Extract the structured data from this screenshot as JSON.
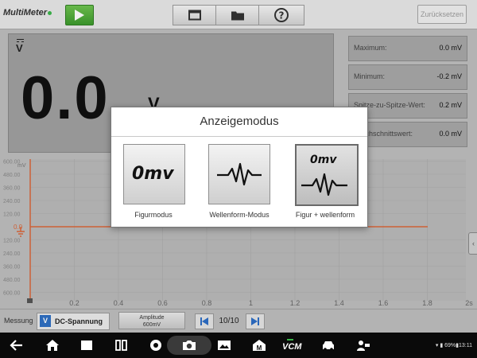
{
  "app": {
    "title": "MultiMeter",
    "reset_label": "Zurücksetzen"
  },
  "display": {
    "dc_symbol": "V",
    "value": "0.0",
    "unit": "V"
  },
  "stats": [
    {
      "label": "Maximum:",
      "value": "0.0 mV"
    },
    {
      "label": "Minimum:",
      "value": "-0.2 mV"
    },
    {
      "label": "Spitze-zu-Spitze-Wert:",
      "value": "0.2 mV"
    },
    {
      "label": "Durchschnittswert:",
      "value": "0.0 mV"
    }
  ],
  "chart": {
    "y_ticks_top": [
      "600.00",
      "480.00",
      "360.00",
      "240.00",
      "120.00"
    ],
    "y_unit": "mV",
    "zero_label": "0.0",
    "y_ticks_bottom": [
      "120.00",
      "240.00",
      "360.00",
      "480.00",
      "600.00"
    ],
    "x_ticks": [
      "0.2",
      "0.4",
      "0.6",
      "0.8",
      "1",
      "1.2",
      "1.4",
      "1.6",
      "1.8",
      "2s"
    ],
    "colors": {
      "signal": "#d9663a",
      "axis": "#d9663a",
      "grid": "#a9a9a9"
    }
  },
  "bottom": {
    "mess_label": "Messung",
    "mode": "DC-Spannung",
    "mode_icon": "V",
    "amplitude_label": "Amplitude",
    "amplitude_value": "600mV",
    "page": "10/10"
  },
  "dialog": {
    "title": "Anzeigemodus",
    "icon_text": "0mv",
    "options": [
      {
        "label": "Figurmodus",
        "selected": false
      },
      {
        "label": "Wellenform-Modus",
        "selected": false
      },
      {
        "label": "Figur + wellenform",
        "selected": true
      }
    ]
  },
  "status": {
    "battery": "69%",
    "time": "13:11"
  }
}
